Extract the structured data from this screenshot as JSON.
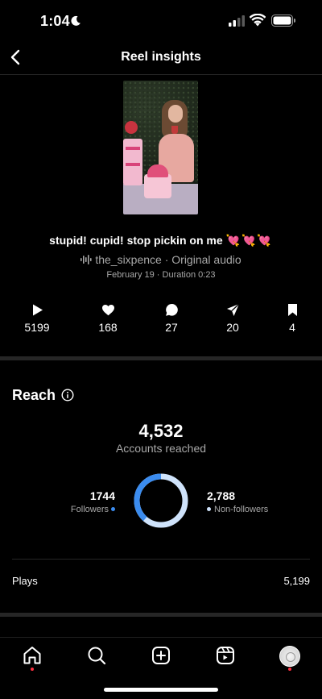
{
  "status_bar": {
    "time": "1:04",
    "icons": [
      "moon-icon",
      "cellular-signal-icon",
      "wifi-icon",
      "battery-icon"
    ]
  },
  "header": {
    "title": "Reel insights",
    "back_icon": "chevron-left-icon"
  },
  "reel": {
    "caption": "stupid! cupid! stop pickin on me",
    "caption_emoji": "💘💘💘",
    "audio": "the_sixpence · Original audio",
    "meta": "February 19 · Duration 0:23"
  },
  "stats": [
    {
      "icon": "play-icon",
      "value": "5199"
    },
    {
      "icon": "heart-icon",
      "value": "168"
    },
    {
      "icon": "comment-icon",
      "value": "27"
    },
    {
      "icon": "share-icon",
      "value": "20"
    },
    {
      "icon": "bookmark-icon",
      "value": "4"
    }
  ],
  "reach": {
    "title": "Reach",
    "accounts_reached": "4,532",
    "accounts_reached_label": "Accounts reached",
    "followers_value": "1744",
    "followers_label": "Followers",
    "non_followers_value": "2,788",
    "non_followers_label": "Non-followers",
    "followers_fraction": 0.385,
    "colors": {
      "followers": "#3b8cef",
      "non_followers": "#cfe3fb"
    }
  },
  "plays_row": {
    "label": "Plays",
    "value": "5,199"
  },
  "bottom_nav": [
    "home-icon",
    "search-icon",
    "create-icon",
    "reels-icon",
    "profile-avatar"
  ]
}
